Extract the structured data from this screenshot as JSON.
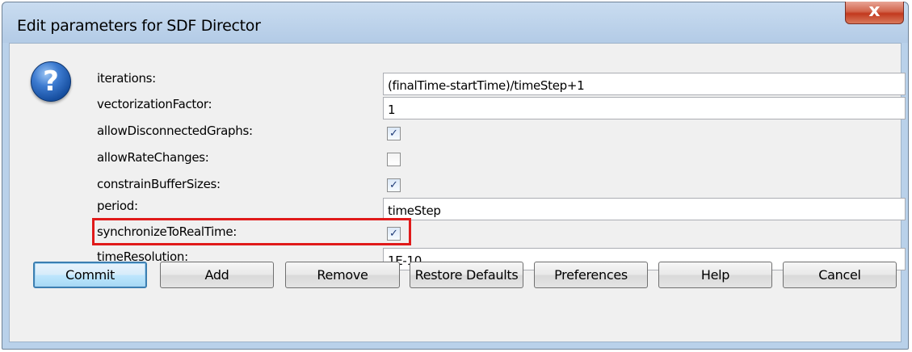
{
  "window": {
    "title": "Edit parameters for SDF Director",
    "close_glyph": "x"
  },
  "icon": {
    "name": "help-question-icon",
    "glyph": "?"
  },
  "parameters": [
    {
      "label": "iterations:",
      "type": "text",
      "value": "(finalTime-startTime)/timeStep+1"
    },
    {
      "label": "vectorizationFactor:",
      "type": "text",
      "value": "1"
    },
    {
      "label": "allowDisconnectedGraphs:",
      "type": "checkbox",
      "checked": true
    },
    {
      "label": "allowRateChanges:",
      "type": "checkbox",
      "checked": false
    },
    {
      "label": "constrainBufferSizes:",
      "type": "checkbox",
      "checked": true
    },
    {
      "label": "period:",
      "type": "text",
      "value": "timeStep"
    },
    {
      "label": "synchronizeToRealTime:",
      "type": "checkbox",
      "checked": true,
      "highlighted": true
    },
    {
      "label": "timeResolution:",
      "type": "text",
      "value": "1E-10"
    }
  ],
  "buttons": {
    "commit": "Commit",
    "add": "Add",
    "remove": "Remove",
    "restore": "Restore Defaults",
    "preferences": "Preferences",
    "help": "Help",
    "cancel": "Cancel"
  },
  "colors": {
    "highlight": "#e01a1a",
    "title_bar": "#b9d1ea",
    "close_button": "#c94a2e"
  }
}
